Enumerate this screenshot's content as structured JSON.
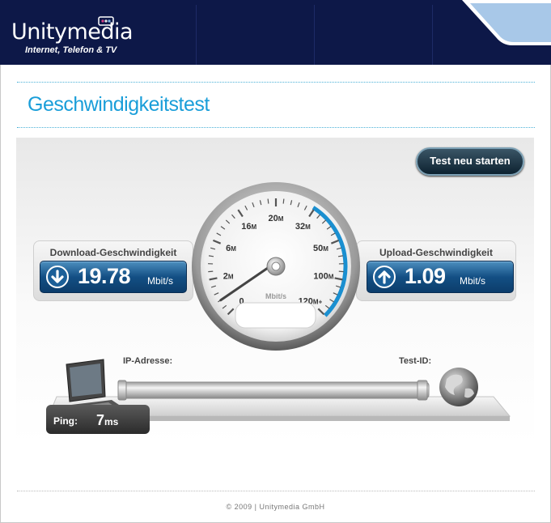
{
  "brand": {
    "name": "Unitymedia",
    "tagline": "Internet, Telefon & TV"
  },
  "page": {
    "title": "Geschwindigkeitstest"
  },
  "restart_button": {
    "label": "Test neu starten"
  },
  "download": {
    "label": "Download-Geschwindigkeit",
    "value": "19.78",
    "unit": "Mbit/s"
  },
  "upload": {
    "label": "Upload-Geschwindigkeit",
    "value": "1.09",
    "unit": "Mbit/s"
  },
  "gauge": {
    "scale_labels": [
      {
        "num": "0",
        "suffix": ""
      },
      {
        "num": "2",
        "suffix": "M"
      },
      {
        "num": "6",
        "suffix": "M"
      },
      {
        "num": "16",
        "suffix": "M"
      },
      {
        "num": "20",
        "suffix": "M"
      },
      {
        "num": "32",
        "suffix": "M"
      },
      {
        "num": "50",
        "suffix": "M"
      },
      {
        "num": "100",
        "suffix": "M"
      },
      {
        "num": "120",
        "suffix": "M+"
      }
    ],
    "unit_label": "Mbit/s",
    "needle_value_fraction": 0.05
  },
  "connection": {
    "ip_label": "IP-Adresse:",
    "test_id_label": "Test-ID:"
  },
  "ping": {
    "label": "Ping:",
    "value": "7",
    "unit": "ms"
  },
  "footer": {
    "copyright": "© 2009 | Unitymedia GmbH"
  },
  "colors": {
    "header_bg": "#0d1848",
    "accent_blue": "#1a9ed9",
    "display_blue": "#134f84",
    "gauge_arc": "#1a8fd0"
  }
}
